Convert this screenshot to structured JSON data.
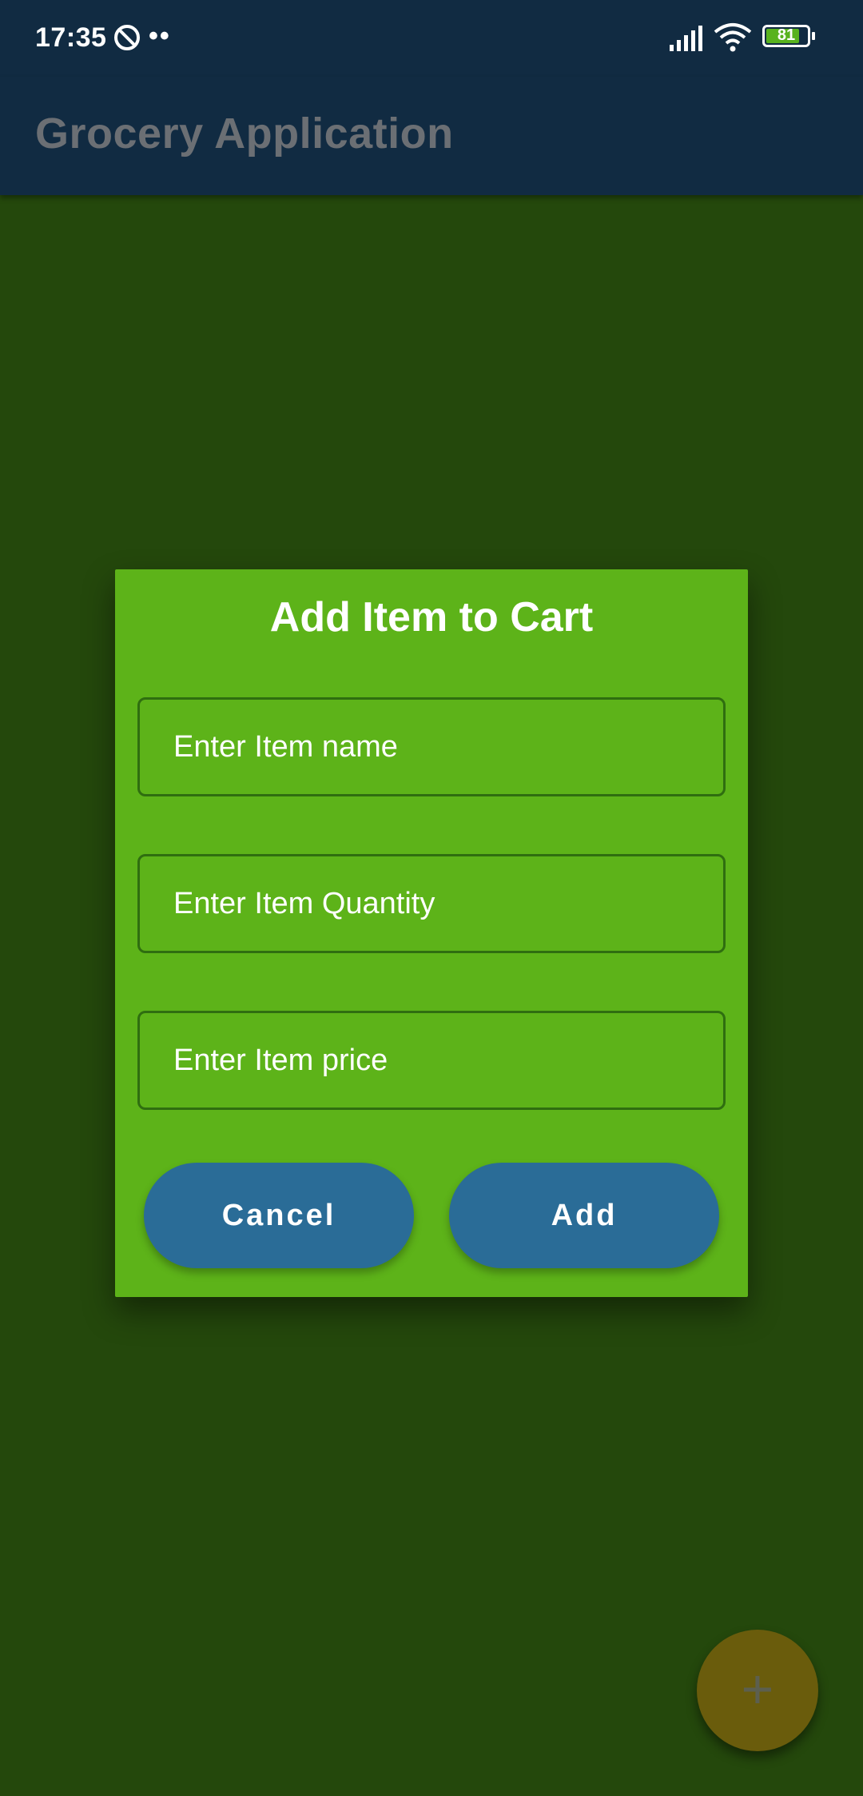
{
  "status_bar": {
    "time": "17:35",
    "dots": "••",
    "battery_level": "81",
    "battery_fraction": 0.81,
    "icons": [
      "dnd-icon",
      "signal-icon",
      "wifi-icon",
      "battery-icon"
    ]
  },
  "app_bar": {
    "title": "Grocery Application"
  },
  "dialog": {
    "title": "Add Item to Cart",
    "fields": {
      "name": {
        "placeholder": "Enter Item name",
        "value": ""
      },
      "quantity": {
        "placeholder": "Enter Item Quantity",
        "value": ""
      },
      "price": {
        "placeholder": "Enter Item price",
        "value": ""
      }
    },
    "buttons": {
      "cancel": "Cancel",
      "add": "Add"
    }
  },
  "fab": {
    "icon": "plus-icon",
    "glyph": "+"
  },
  "colors": {
    "app_bar": "#112b42",
    "dialog_bg": "#5db319",
    "scrim_bg": "#24480c",
    "button": "#2a6c97",
    "fab": "#6a5c0c"
  }
}
